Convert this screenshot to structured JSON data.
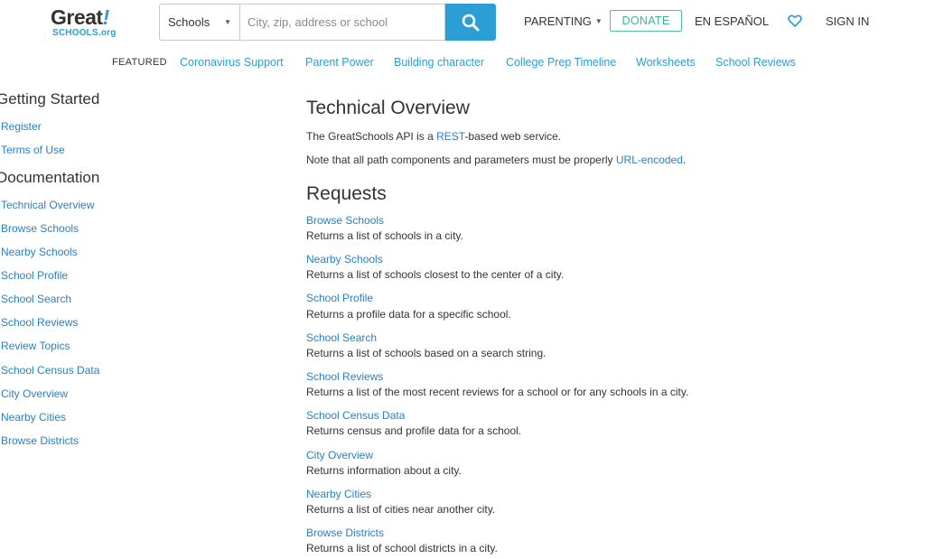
{
  "header": {
    "logo_main": "Great",
    "logo_bang": "!",
    "logo_sub": "SCHOOLS.org",
    "search_select": "Schools",
    "search_placeholder": "City, zip, address or school",
    "parenting": "PARENTING",
    "donate": "DONATE",
    "espanol": "EN ESPAÑOL",
    "signin": "SIGN IN"
  },
  "featured": {
    "label": "FEATURED",
    "links": [
      "Coronavirus Support",
      "Parent Power",
      "Building character",
      "College Prep Timeline",
      "Worksheets",
      "School Reviews"
    ]
  },
  "sidebar": {
    "getting_started": "Getting Started",
    "getting_started_links": [
      "Register",
      "Terms of Use"
    ],
    "documentation": "Documentation",
    "documentation_links": [
      "Technical Overview",
      "Browse Schools",
      "Nearby Schools",
      "School Profile",
      "School Search",
      "School Reviews",
      "Review Topics",
      "School Census Data",
      "City Overview",
      "Nearby Cities",
      "Browse Districts"
    ]
  },
  "main": {
    "title": "Technical Overview",
    "p1_before": "The GreatSchools API is a ",
    "p1_link": "REST",
    "p1_after": "-based web service.",
    "p2_before": "Note that all path components and parameters must be properly ",
    "p2_link": "URL-encoded",
    "p2_after": ".",
    "requests_title": "Requests",
    "requests": [
      {
        "name": "Browse Schools",
        "desc": "Returns a list of schools in a city."
      },
      {
        "name": "Nearby Schools",
        "desc": "Returns a list of schools closest to the center of a city."
      },
      {
        "name": "School Profile",
        "desc": "Returns a profile data for a specific school."
      },
      {
        "name": "School Search",
        "desc": "Returns a list of schools based on a search string."
      },
      {
        "name": "School Reviews",
        "desc": "Returns a list of the most recent reviews for a school or for any schools in a city."
      },
      {
        "name": "School Census Data",
        "desc": "Returns census and profile data for a school."
      },
      {
        "name": "City Overview",
        "desc": "Returns information about a city."
      },
      {
        "name": "Nearby Cities",
        "desc": "Returns a list of cities near another city."
      },
      {
        "name": "Browse Districts",
        "desc": "Returns a list of school districts in a city."
      }
    ]
  }
}
